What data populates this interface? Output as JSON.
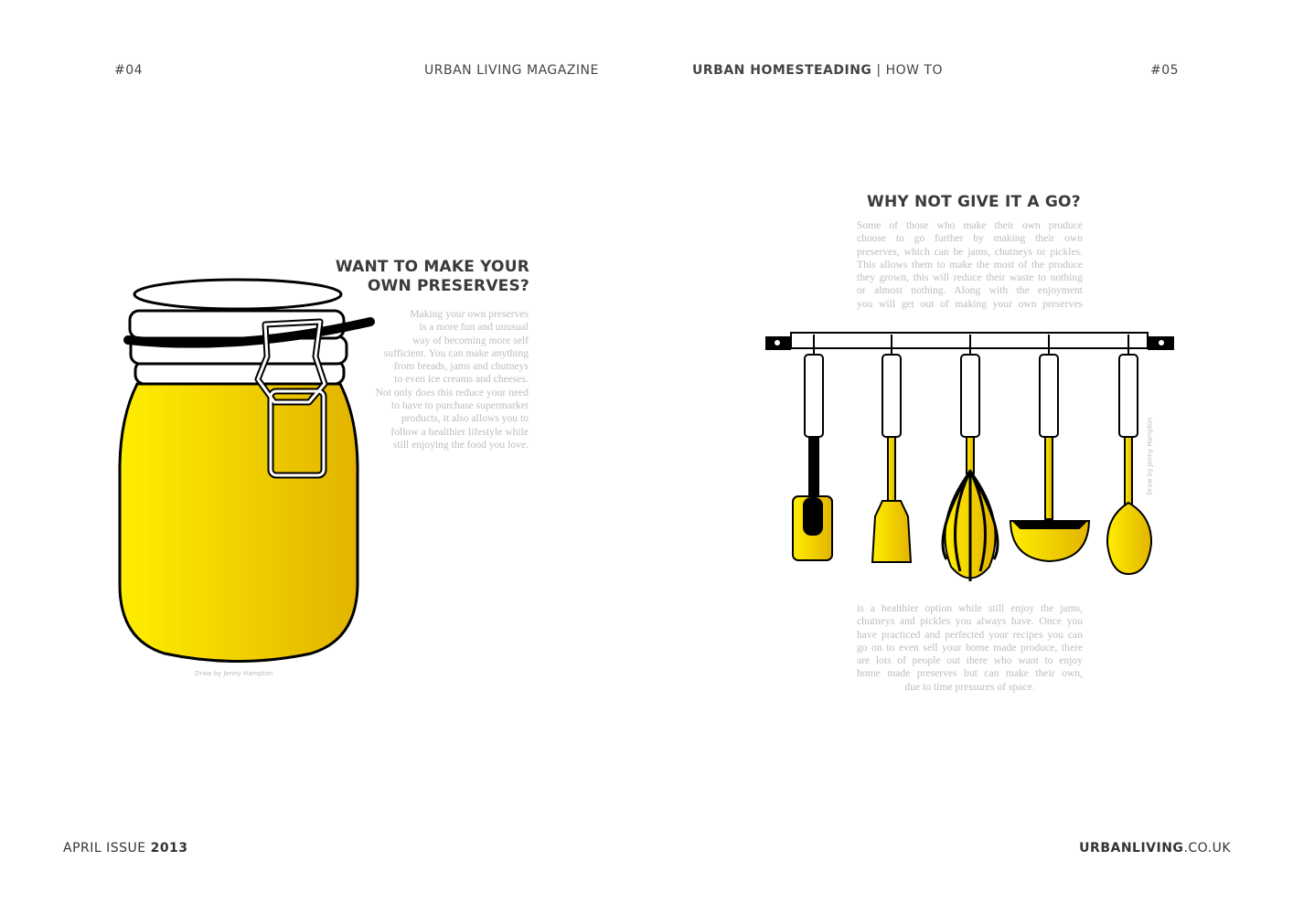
{
  "header": {
    "left_page_number": "#04",
    "left_title": "URBAN LIVING MAGAZINE",
    "right_title_bold": "URBAN HOMESTEADING",
    "right_title_sep": " | ",
    "right_title_rest": "HOW TO",
    "right_page_number": "#05"
  },
  "left_article": {
    "heading_line1": "WANT TO MAKE YOUR",
    "heading_line2": "OWN PRESERVES?",
    "lines": [
      "Making your own preserves",
      "is a more fun and unusual",
      "way of becoming more self",
      "sufficient. You can make anything",
      "from breads, jams and chutneys",
      "to even ice creams and cheeses.",
      "Not only does this reduce your need",
      "to have to purchase supermarket",
      "products, it also allows you to",
      "follow a healthier lifestyle while",
      "still enjoying the food you love."
    ],
    "illustration_credit": "Draw by Jenny Hampton"
  },
  "right_article": {
    "heading": "WHY NOT GIVE IT A GO?",
    "lines_top": [
      "Some of those who make their own produce",
      "choose to go further by making their own",
      "preserves, which can be jams, chutneys or pickles.",
      "This allows them to make the most of the produce",
      "they grown, this will reduce their waste to nothing",
      "or almost nothing. Along with the enjoyment",
      "you will get out of making your own preserves"
    ],
    "lines_bottom": [
      "is a healthier option while still enjoy the jams,",
      "chutneys and pickles you always have. Once you",
      "have practiced and perfected your recipes you can",
      "go on to even sell your home made produce, there",
      "are lots of people out there who want to enjoy",
      "home made preserves but can  make their own,",
      "due to time pressures of space."
    ],
    "illustration_credit": "Draw by Jenny Hampton"
  },
  "footer": {
    "issue_text": "APRIL ISSUE ",
    "issue_year": "2013",
    "site_bold": "URBANLIVING",
    "site_rest": ".CO.UK"
  },
  "colors": {
    "accent_yellow": "#FFE600",
    "accent_yellow_dark": "#E3B400",
    "text_grey": "#bdbdbd",
    "heading": "#3a3a3a"
  }
}
